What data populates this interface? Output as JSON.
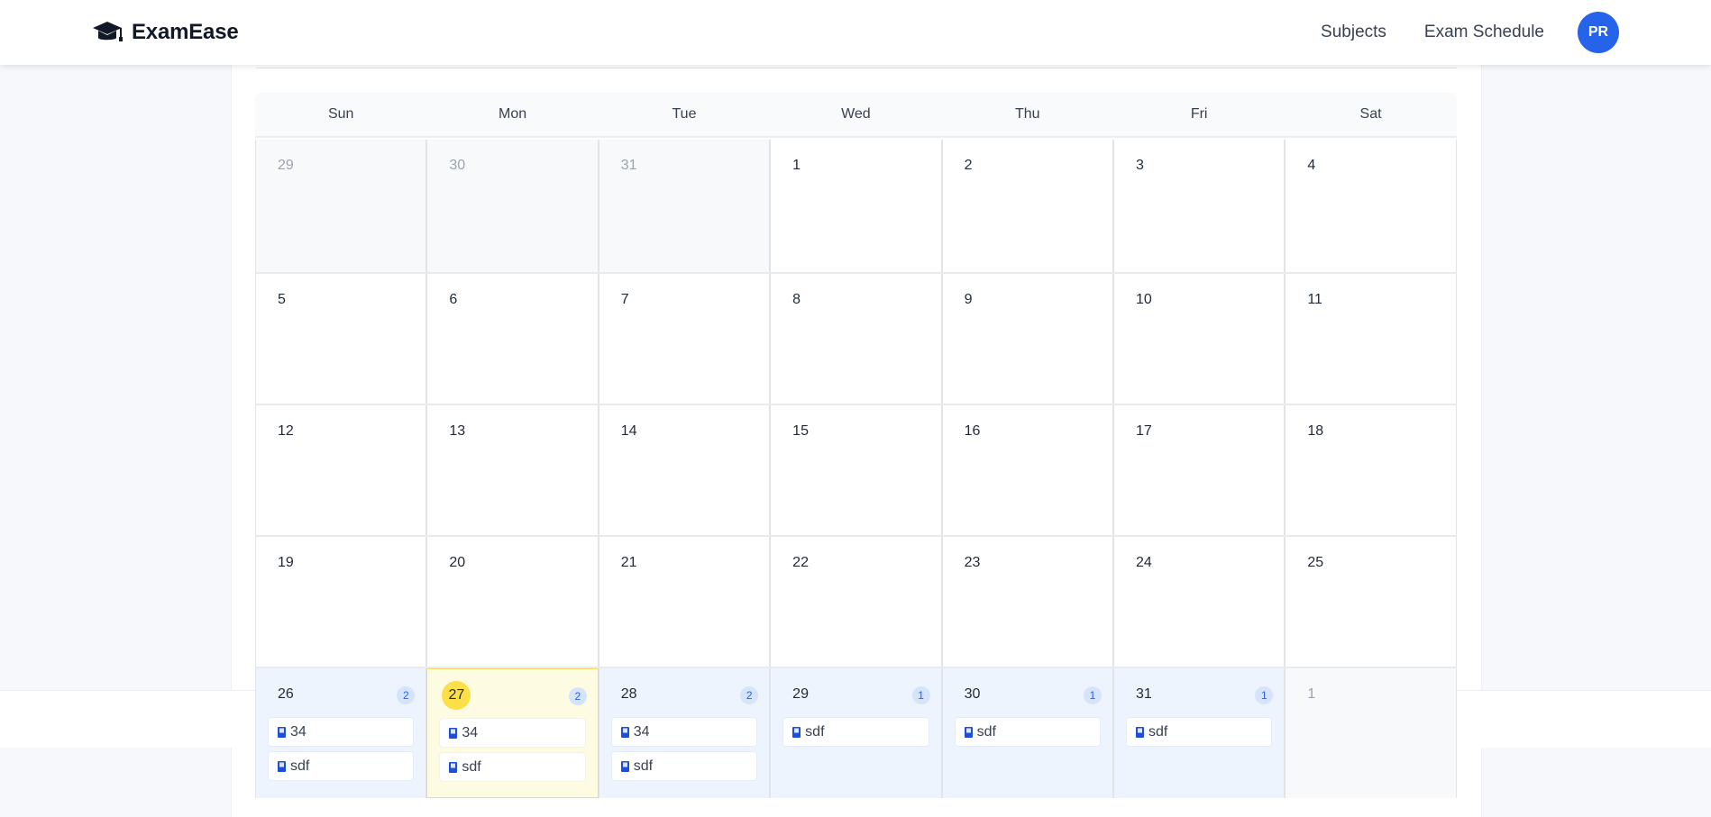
{
  "app": {
    "name": "ExamEase"
  },
  "nav": {
    "links": [
      "Subjects",
      "Exam Schedule"
    ],
    "avatar_initials": "PR"
  },
  "colors": {
    "accent": "#2563eb",
    "today": "#fde047",
    "event_day": "#eef4fd"
  },
  "calendar": {
    "weekdays": [
      "Sun",
      "Mon",
      "Tue",
      "Wed",
      "Thu",
      "Fri",
      "Sat"
    ],
    "weeks": [
      [
        {
          "day": "29",
          "other": true
        },
        {
          "day": "30",
          "other": true
        },
        {
          "day": "31",
          "other": true
        },
        {
          "day": "1"
        },
        {
          "day": "2"
        },
        {
          "day": "3"
        },
        {
          "day": "4"
        }
      ],
      [
        {
          "day": "5"
        },
        {
          "day": "6"
        },
        {
          "day": "7"
        },
        {
          "day": "8"
        },
        {
          "day": "9"
        },
        {
          "day": "10"
        },
        {
          "day": "11"
        }
      ],
      [
        {
          "day": "12"
        },
        {
          "day": "13"
        },
        {
          "day": "14"
        },
        {
          "day": "15"
        },
        {
          "day": "16"
        },
        {
          "day": "17"
        },
        {
          "day": "18"
        }
      ],
      [
        {
          "day": "19"
        },
        {
          "day": "20"
        },
        {
          "day": "21"
        },
        {
          "day": "22"
        },
        {
          "day": "23"
        },
        {
          "day": "24"
        },
        {
          "day": "25"
        }
      ],
      [
        {
          "day": "26",
          "count": "2",
          "events": [
            "34",
            "sdf"
          ]
        },
        {
          "day": "27",
          "today": true,
          "count": "2",
          "events": [
            "34",
            "sdf"
          ]
        },
        {
          "day": "28",
          "count": "2",
          "events": [
            "34",
            "sdf"
          ]
        },
        {
          "day": "29",
          "count": "1",
          "events": [
            "sdf"
          ]
        },
        {
          "day": "30",
          "count": "1",
          "events": [
            "sdf"
          ]
        },
        {
          "day": "31",
          "count": "1",
          "events": [
            "sdf"
          ]
        },
        {
          "day": "1",
          "other": true
        }
      ]
    ]
  }
}
